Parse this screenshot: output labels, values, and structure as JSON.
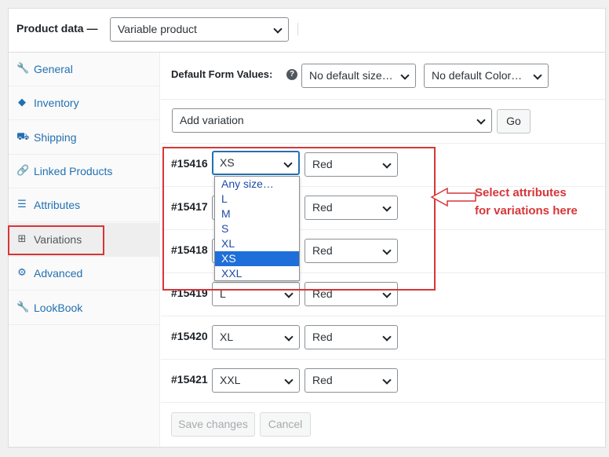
{
  "header": {
    "title": "Product data —",
    "product_type": "Variable product"
  },
  "sidebar": {
    "items": [
      {
        "label": "General",
        "icon": "wrench-icon"
      },
      {
        "label": "Inventory",
        "icon": "tag-icon"
      },
      {
        "label": "Shipping",
        "icon": "truck-icon"
      },
      {
        "label": "Linked Products",
        "icon": "link-icon"
      },
      {
        "label": "Attributes",
        "icon": "list-icon"
      },
      {
        "label": "Variations",
        "icon": "grid-icon",
        "active": true
      },
      {
        "label": "Advanced",
        "icon": "gear-icon"
      },
      {
        "label": "LookBook",
        "icon": "wrench-icon"
      }
    ]
  },
  "defaults": {
    "label": "Default Form Values:",
    "size": "No default size…",
    "color": "No default Color…"
  },
  "add_variation": {
    "select": "Add variation",
    "go_label": "Go"
  },
  "variations": [
    {
      "id": "#15416",
      "size": "XS",
      "color": "Red"
    },
    {
      "id": "#15417",
      "size": "",
      "color": "Red"
    },
    {
      "id": "#15418",
      "size": "",
      "color": "Red"
    },
    {
      "id": "#15419",
      "size": "L",
      "color": "Red"
    },
    {
      "id": "#15420",
      "size": "XL",
      "color": "Red"
    },
    {
      "id": "#15421",
      "size": "XXL",
      "color": "Red"
    }
  ],
  "size_dropdown": {
    "options": [
      "Any size…",
      "L",
      "M",
      "S",
      "XL",
      "XS",
      "XXL"
    ],
    "selected": "XS"
  },
  "footer": {
    "save_label": "Save changes",
    "cancel_label": "Cancel"
  },
  "annotation": {
    "line1": "Select attributes",
    "line2": "for variations here",
    "color": "#d63638"
  },
  "colors": {
    "link": "#2271b1",
    "highlight": "#1e6fd9"
  }
}
